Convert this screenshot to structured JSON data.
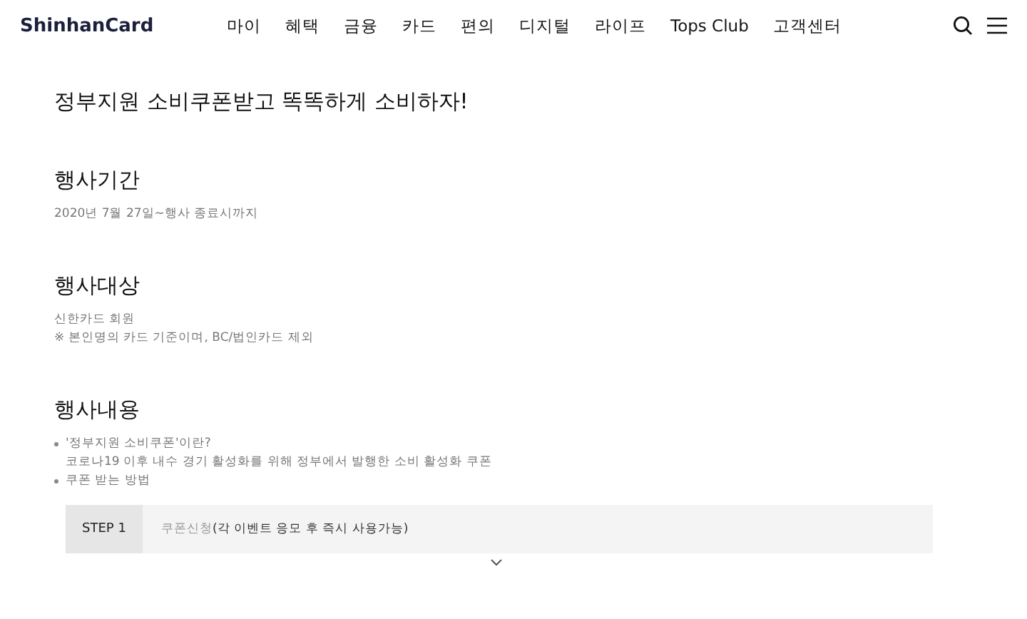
{
  "header": {
    "logo": "ShinhanCard",
    "nav": [
      "마이",
      "혜택",
      "금융",
      "카드",
      "편의",
      "디지털",
      "라이프",
      "Tops Club",
      "고객센터"
    ]
  },
  "title": "정부지원 소비쿠폰받고 똑똑하게 소비하자!",
  "sections": [
    {
      "heading": "행사기간",
      "lines": [
        {
          "kind": "plain",
          "text": "2020년 7월 27일~행사 종료시까지"
        }
      ]
    },
    {
      "heading": "행사대상",
      "lines": [
        {
          "kind": "plain",
          "text": "신한카드 회원"
        },
        {
          "kind": "plain",
          "text": "※ 본인명의 카드 기준이며, BC/법인카드 제외"
        }
      ]
    },
    {
      "heading": "행사내용",
      "lines": [
        {
          "kind": "bullet",
          "text": "'정부지원 소비쿠폰'이란?"
        },
        {
          "kind": "plain",
          "text": "코로나19 이후 내수 경기 활성화를 위해 정부에서 발행한 소비 활성화 쿠폰"
        },
        {
          "kind": "bullet",
          "text": "쿠폰 받는 방법"
        }
      ],
      "steps": [
        {
          "label": "STEP 1",
          "text": "쿠폰신청**(각 이벤트 응모 후 즉시 사용가능)**"
        }
      ]
    }
  ]
}
